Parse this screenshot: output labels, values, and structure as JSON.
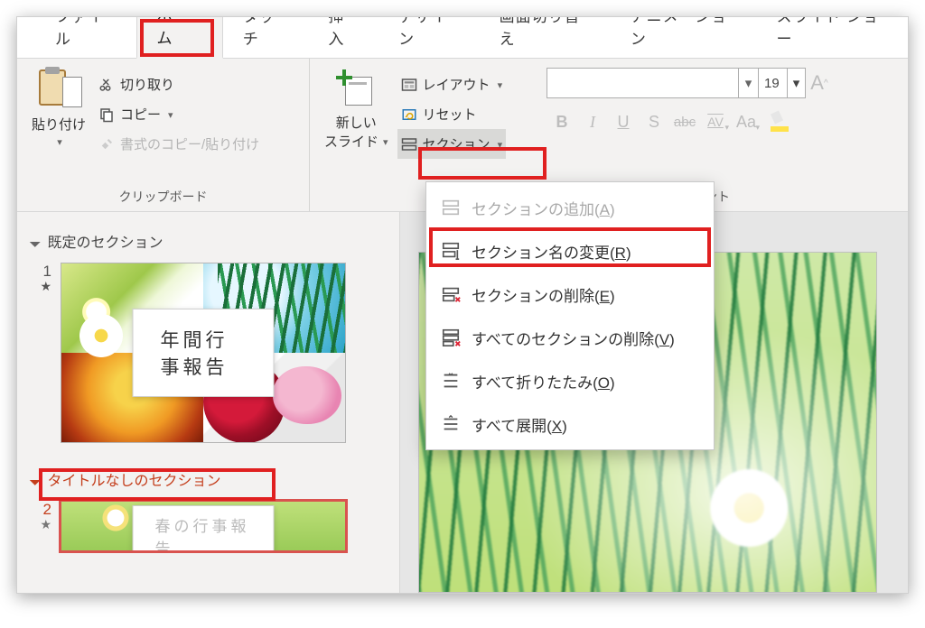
{
  "tabs": {
    "file": "ファイル",
    "home": "ホーム",
    "touch": "タッチ",
    "insert": "挿入",
    "design": "デザイン",
    "transitions": "画面切り替え",
    "animations": "アニメーション",
    "slideshow": "スライド ショー"
  },
  "clipboard": {
    "paste": "貼り付け",
    "cut": "切り取り",
    "copy": "コピー",
    "format_painter": "書式のコピー/貼り付け",
    "group_label": "クリップボード"
  },
  "slides": {
    "new_slide_l1": "新しい",
    "new_slide_l2": "スライド",
    "layout": "レイアウト",
    "reset": "リセット",
    "section": "セクション"
  },
  "font": {
    "size": "19",
    "group_label": "フォント",
    "bold": "B",
    "italic": "I",
    "underline": "U",
    "shadow": "S",
    "strike": "abc",
    "char_spacing": "AV",
    "change_case": "Aa",
    "grow": "A",
    "shrink": "A"
  },
  "sections": {
    "default": "既定のセクション",
    "untitled": "タイトルなしのセクション"
  },
  "slide1": {
    "num": "1",
    "star": "★",
    "title": "年間行事報告"
  },
  "slide2": {
    "num": "2",
    "star": "★",
    "title_partial": "春の行事報告"
  },
  "menu": {
    "add": {
      "pre": "セクションの追加(",
      "key": "A",
      "post": ")"
    },
    "rename": {
      "pre": "セクション名の変更(",
      "key": "R",
      "post": ")"
    },
    "remove": {
      "pre": "セクションの削除(",
      "key": "E",
      "post": ")"
    },
    "remove_all": {
      "pre": "すべてのセクションの削除(",
      "key": "V",
      "post": ")"
    },
    "collapse_all": {
      "pre": "すべて折りたたみ(",
      "key": "O",
      "post": ")"
    },
    "expand_all": {
      "pre": "すべて展開(",
      "key": "X",
      "post": ")"
    }
  }
}
